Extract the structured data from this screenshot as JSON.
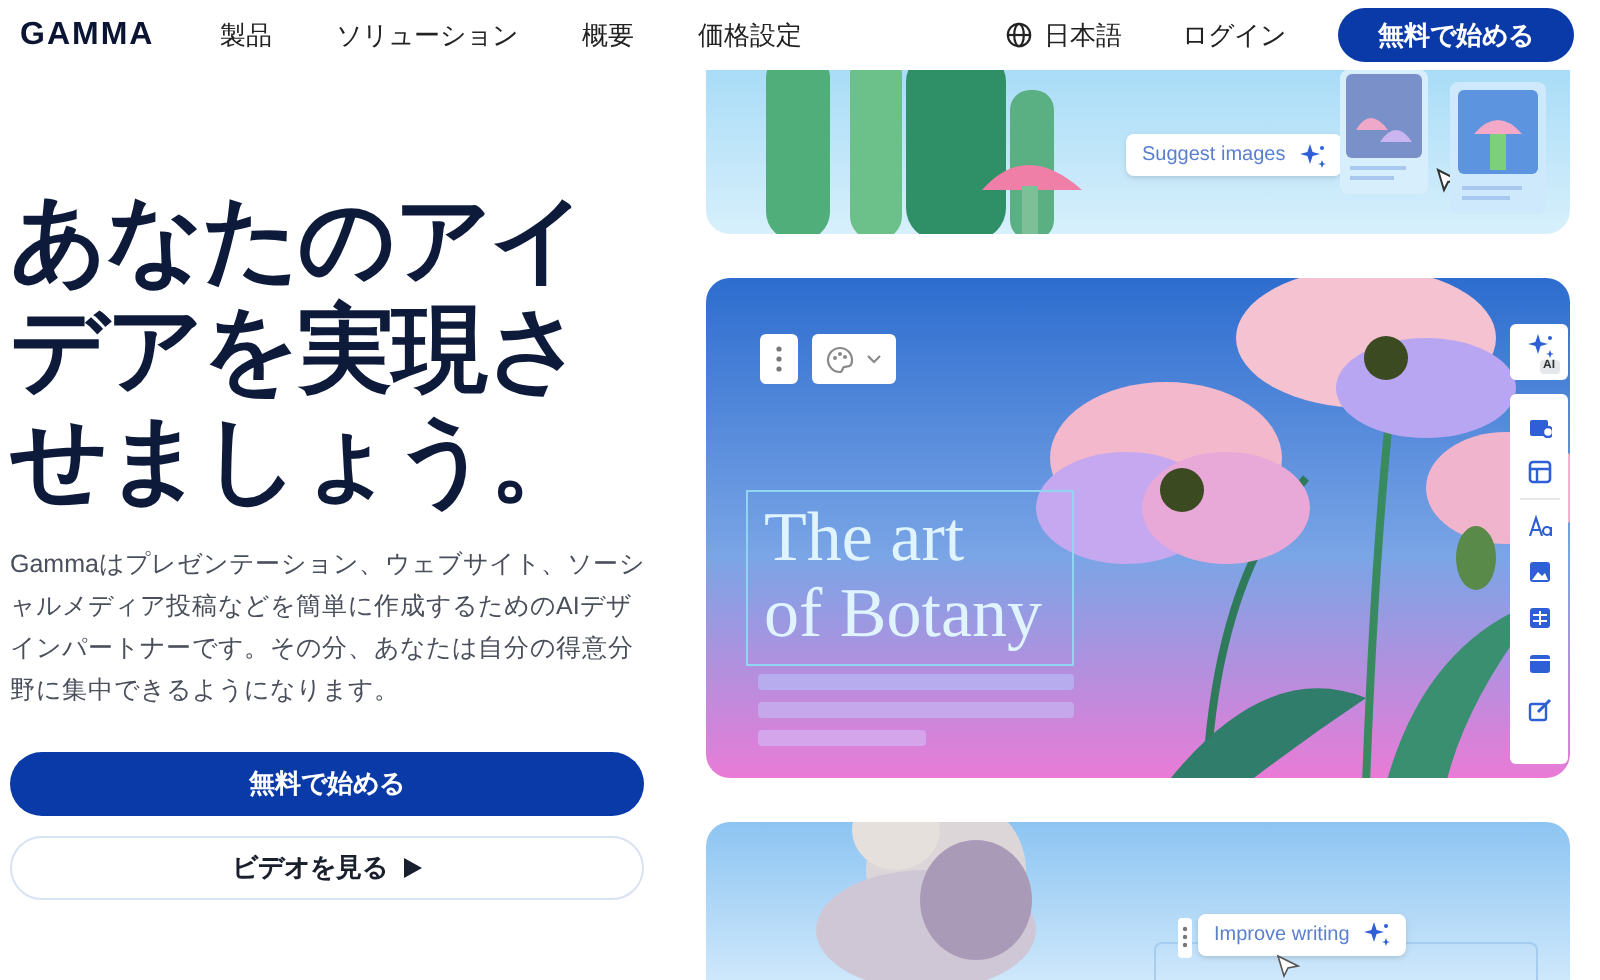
{
  "nav": {
    "logo": "GAMMA",
    "links": [
      "製品",
      "ソリューション",
      "概要",
      "価格設定"
    ],
    "language": "日本語",
    "login": "ログイン",
    "cta": "無料で始める"
  },
  "hero": {
    "heading": "あなたのアイデアを実現させましょう。",
    "description": "Gammaはプレゼンテーション、ウェブサイト、ソーシャルメディア投稿などを簡単に作成するためのAIデザインパートナーです。その分、あなたは自分の得意分野に集中できるようになります。",
    "buttons": [
      {
        "kind": "primary",
        "label": "無料で始める"
      },
      {
        "kind": "video",
        "label": "ビデオを見る"
      }
    ]
  },
  "showcase": [
    {
      "kind": "images",
      "chip": "Suggest images"
    },
    {
      "kind": "slide",
      "title_lines": [
        "The art",
        "of Botany"
      ],
      "ai_badge": "AI"
    },
    {
      "kind": "writing",
      "chip": "Improve writing"
    }
  ]
}
